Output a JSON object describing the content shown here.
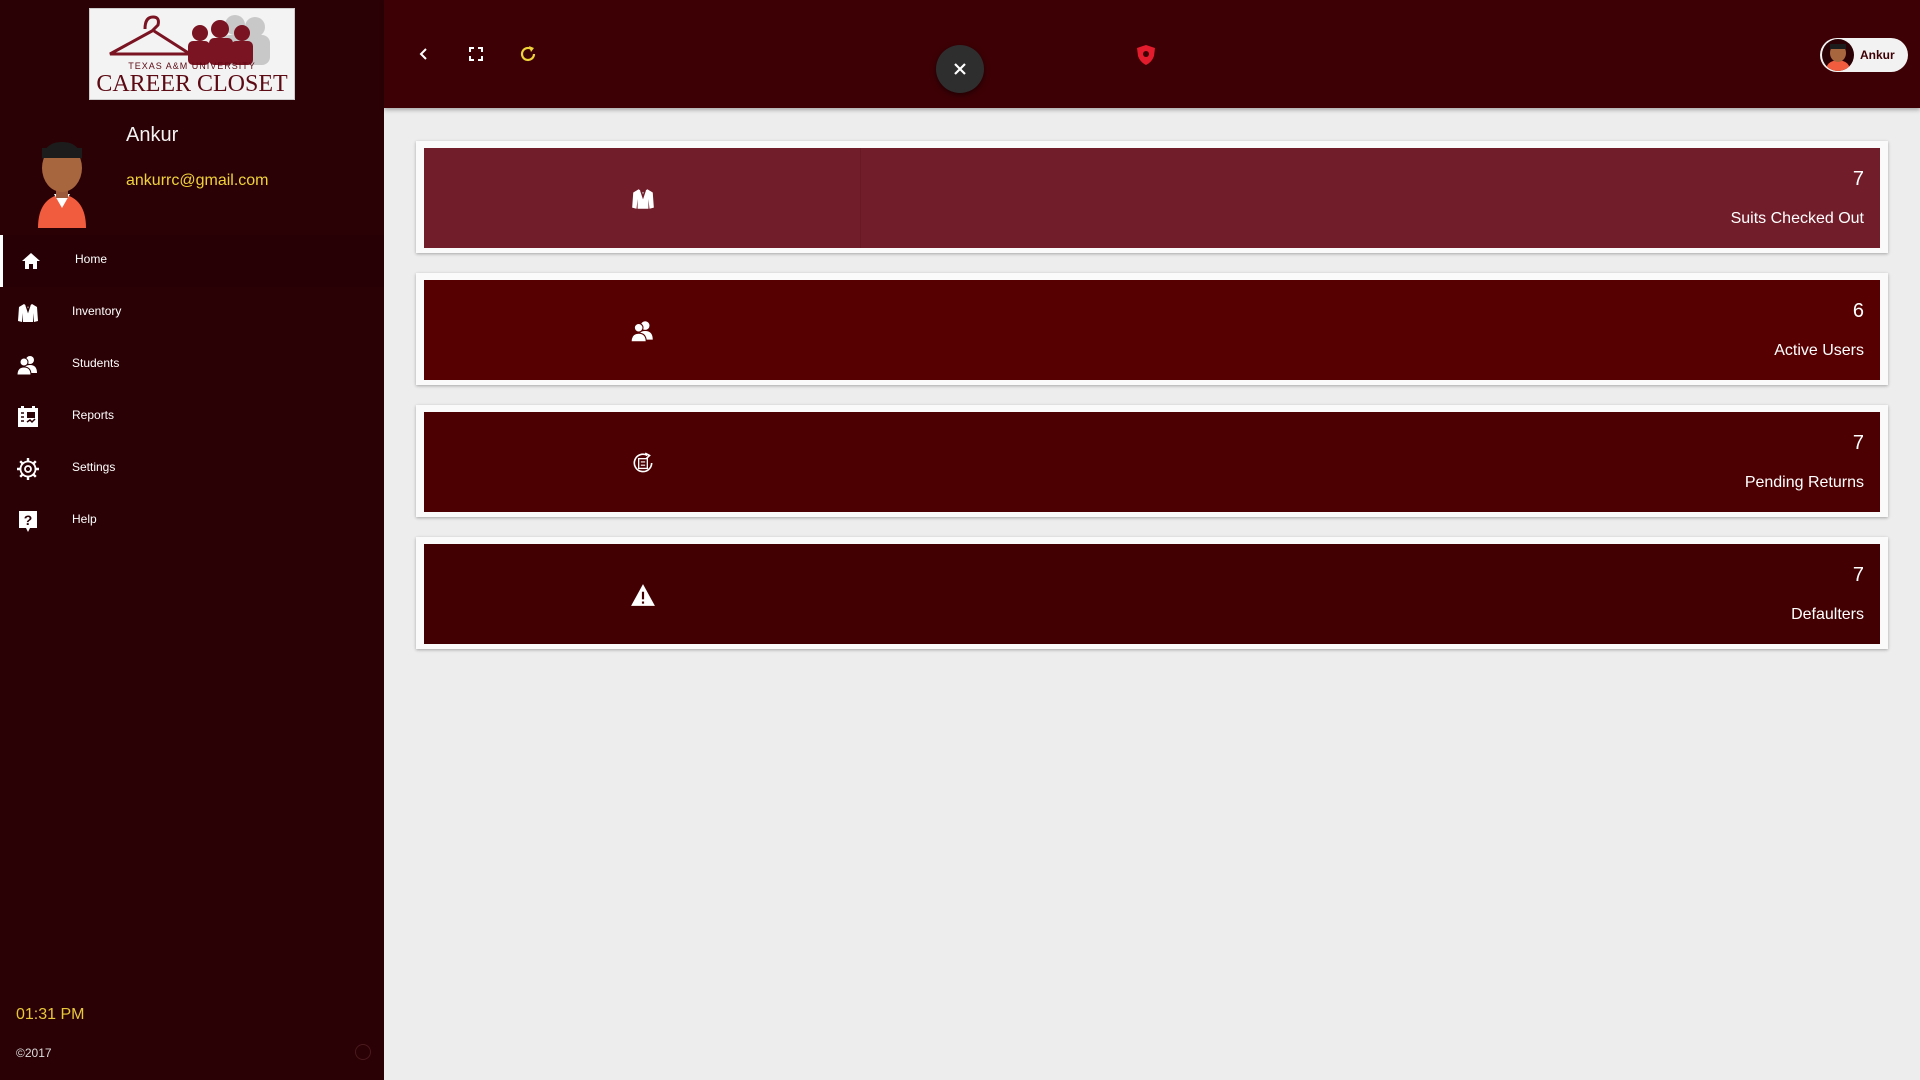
{
  "logo": {
    "subtitle": "TEXAS A&M UNIVERSITY",
    "title": "CAREER CLOSET"
  },
  "profile": {
    "name": "Ankur",
    "email": "ankurrc@gmail.com"
  },
  "nav": {
    "items": [
      {
        "label": "Home",
        "icon": "home-icon",
        "active": true
      },
      {
        "label": "Inventory",
        "icon": "suit-icon"
      },
      {
        "label": "Students",
        "icon": "users-icon"
      },
      {
        "label": "Reports",
        "icon": "reports-icon"
      },
      {
        "label": "Settings",
        "icon": "gear-icon"
      },
      {
        "label": "Help",
        "icon": "help-icon"
      }
    ]
  },
  "footer": {
    "time": "01:31 PM",
    "copyright": "©2017"
  },
  "topbar": {
    "user_name": "Ankur"
  },
  "colors": {
    "sidebar_bg": "#2a0105",
    "topbar_bg": "#3d0005",
    "card1": "#721d2a",
    "card2": "#570001",
    "card3": "#4d0002",
    "card4": "#430002",
    "accent_yellow": "#f0d33a"
  },
  "cards": [
    {
      "value": "7",
      "label": "Suits Checked Out",
      "icon": "suit-icon"
    },
    {
      "value": "6",
      "label": "Active Users",
      "icon": "users-icon"
    },
    {
      "value": "7",
      "label": "Pending Returns",
      "icon": "return-icon"
    },
    {
      "value": "7",
      "label": "Defaulters",
      "icon": "warning-icon"
    }
  ]
}
